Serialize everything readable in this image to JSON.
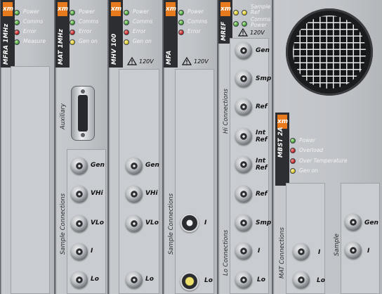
{
  "modules": {
    "mfra": {
      "name": "MFRA 1MHz",
      "brand": "xm",
      "leds": [
        "Power",
        "Comms",
        "Error",
        "Measure"
      ]
    },
    "mat": {
      "name": "MAT 1MHz",
      "brand": "xm",
      "leds": [
        "Power",
        "Comms",
        "Error",
        "Gen on"
      ],
      "aux_label": "Auxiliary",
      "sample_label": "Sample Connections",
      "connectors": [
        "Gen",
        "VHi",
        "VLo",
        "I",
        "Lo"
      ]
    },
    "mhv": {
      "name": "MHV 100",
      "brand": "xm",
      "leds": [
        "Power",
        "Comms",
        "Error",
        "Gen on"
      ],
      "voltage": "120V",
      "connectors": [
        "Gen",
        "VHi",
        "VLo",
        "Lo"
      ]
    },
    "mfa": {
      "name": "MFA",
      "brand": "xm",
      "leds": [
        "Power",
        "Comms",
        "Error"
      ],
      "voltage": "120V",
      "sample_label": "Sample Connections",
      "connectors": [
        "I",
        "Lo"
      ]
    },
    "mref": {
      "name": "MREF",
      "brand": "xm",
      "leds": [
        "Sample Ref",
        "Comms Power"
      ],
      "voltage": "120V",
      "hi_label": "Hi Connections",
      "lo_label": "Lo Connections",
      "connectors": [
        "Gen",
        "Smp",
        "Ref",
        "Int Ref",
        "Int Ref",
        "Ref",
        "Smp",
        "I",
        "Lo"
      ]
    },
    "mbst": {
      "name": "MBST 2A",
      "brand": "xm",
      "leds": [
        "Power",
        "Overload",
        "Over Temperature",
        "Gen on"
      ],
      "mat_label": "MAT Connections",
      "sample_label": "Sample",
      "connectors": [
        "I",
        "Lo",
        "Gen",
        "I"
      ]
    }
  },
  "colors": {
    "led_green": "#4aa33a",
    "led_red": "#c42424",
    "led_yellow": "#d7c52d",
    "brand_orange": "#e67a1d",
    "badge": "#2c2e31"
  }
}
